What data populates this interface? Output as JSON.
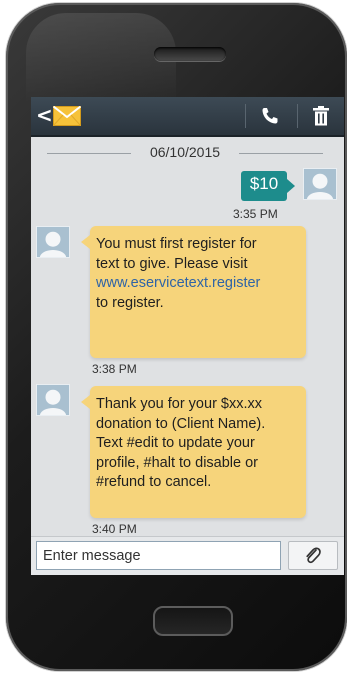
{
  "app": {
    "accent_color": "#1d8c8c",
    "received_bubble_color": "#f6d47b",
    "topbar_color": "#2f3a44"
  },
  "toolbar": {
    "back_icon": "back-arrow-icon",
    "back_glyph": "<",
    "messages_icon": "envelope-icon",
    "call_icon": "phone-icon",
    "delete_icon": "trash-icon"
  },
  "conversation": {
    "date": "06/10/2015",
    "messages": [
      {
        "direction": "sent",
        "text": "$10",
        "time": "3:35 PM"
      },
      {
        "direction": "received",
        "lines": [
          "You must first register for",
          "text to give. Please visit",
          "www.eservicetext.register",
          "to register."
        ],
        "time": "3:38 PM"
      },
      {
        "direction": "received",
        "lines": [
          "Thank you for your $xx.xx",
          "donation to (Client Name).",
          "Text #edit to update your",
          "profile, #halt to disable or",
          "#refund to cancel."
        ],
        "time": "3:40 PM"
      }
    ]
  },
  "composer": {
    "placeholder": "Enter message",
    "attach_icon": "paperclip-icon"
  }
}
